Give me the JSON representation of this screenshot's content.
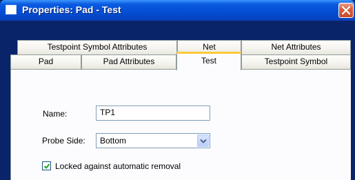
{
  "window": {
    "title": "Properties: Pad - Test",
    "close_icon": "close-icon",
    "app_icon": "window-icon"
  },
  "tabs": {
    "row_back": [
      {
        "label": "Testpoint Symbol Attributes"
      },
      {
        "label": "Net"
      },
      {
        "label": "Net Attributes"
      }
    ],
    "row_front": [
      {
        "label": "Pad"
      },
      {
        "label": "Pad Attributes"
      },
      {
        "label": "Test",
        "selected": true
      },
      {
        "label": "Testpoint Symbol"
      }
    ]
  },
  "form": {
    "name_label": "Name:",
    "name_value": "TP1",
    "probe_side_label": "Probe Side:",
    "probe_side_value": "Bottom",
    "locked_label": "Locked against automatic removal",
    "locked_checked": true
  },
  "colors": {
    "title_bar": "#0550d8",
    "selected_tab_accent": "#ffc83c",
    "close_button": "#c84a2a",
    "dialog_bg": "#ece9d8"
  }
}
